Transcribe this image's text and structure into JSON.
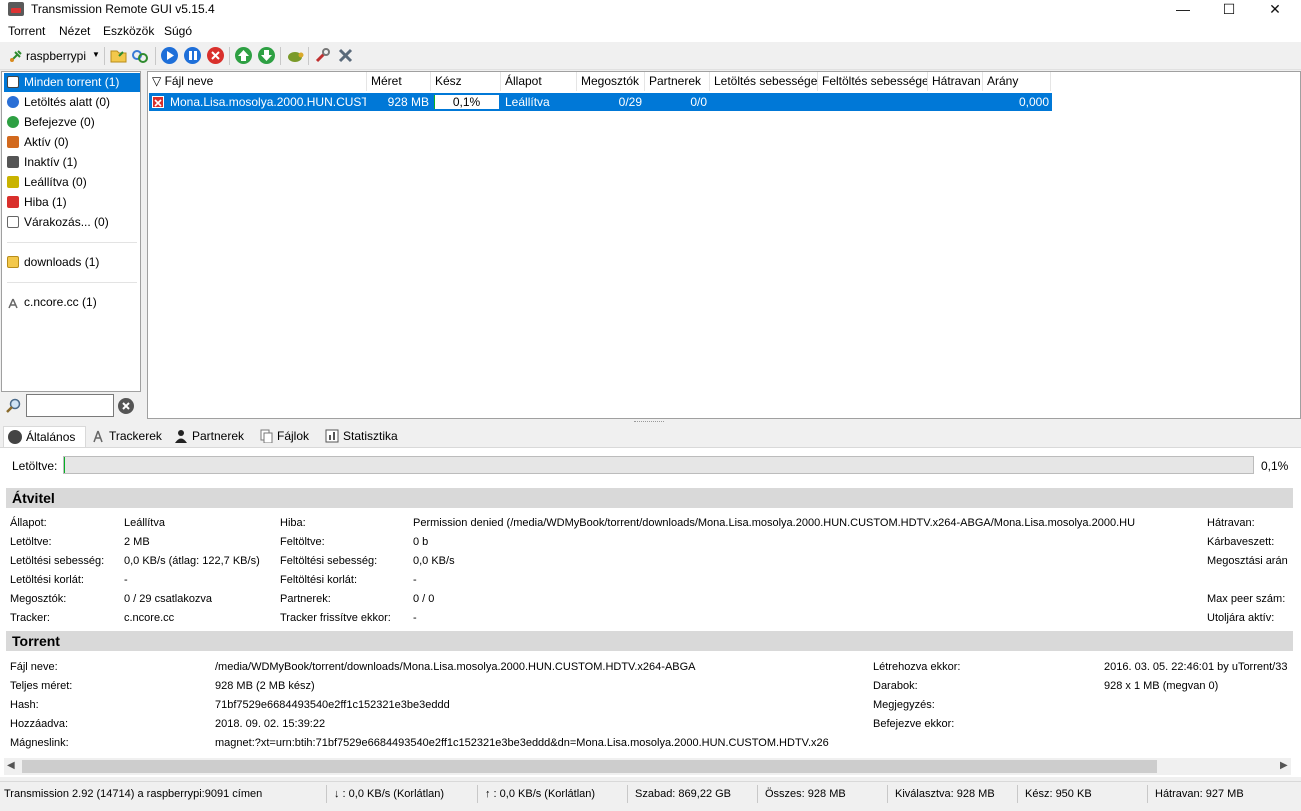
{
  "window": {
    "title": "Transmission Remote GUI v5.15.4",
    "minimize": "—",
    "maximize": "☐",
    "close": "✕"
  },
  "menu": [
    "Torrent",
    "Nézet",
    "Eszközök",
    "Súgó"
  ],
  "toolbar": {
    "connection": "raspberrypi"
  },
  "sidebar": {
    "filters": [
      {
        "label": "Minden torrent (1)",
        "icon": "all-icon",
        "color": "#444444"
      },
      {
        "label": "Letöltés alatt (0)",
        "icon": "download-icon",
        "color": "#2a6fd6"
      },
      {
        "label": "Befejezve (0)",
        "icon": "completed-icon",
        "color": "#2ea043"
      },
      {
        "label": "Aktív (0)",
        "icon": "active-icon",
        "color": "#d2691e"
      },
      {
        "label": "Inaktív (1)",
        "icon": "inactive-icon",
        "color": "#555555"
      },
      {
        "label": "Leállítva (0)",
        "icon": "stopped-icon",
        "color": "#c9b300"
      },
      {
        "label": "Hiba (1)",
        "icon": "error-icon",
        "color": "#d9302c"
      },
      {
        "label": "Várakozás... (0)",
        "icon": "waiting-icon",
        "color": "#666666"
      }
    ],
    "folders": [
      {
        "label": "downloads (1)",
        "icon": "folder-icon"
      }
    ],
    "trackers": [
      {
        "label": "c.ncore.cc (1)",
        "icon": "tracker-icon"
      }
    ]
  },
  "torrent_list": {
    "columns": [
      "Fájl neve",
      "Méret",
      "Kész",
      "Állapot",
      "Megosztók",
      "Partnerek",
      "Letöltés sebessége",
      "Feltöltés sebessége",
      "Hátravan",
      "Arány"
    ],
    "sort_indicator": "▽",
    "rows": [
      {
        "name": "Mona.Lisa.mosolya.2000.HUN.CUSTOM.HDTV.x264-ABGA",
        "size": "928 MB",
        "done": "0,1%",
        "status": "Leállítva",
        "seeds": "0/29",
        "peers": "0/0",
        "down": "",
        "up": "",
        "eta": "",
        "ratio": "0,000"
      }
    ]
  },
  "tabs": [
    "Általános",
    "Trackerek",
    "Partnerek",
    "Fájlok",
    "Statisztika"
  ],
  "general": {
    "downloaded_label": "Letöltve:",
    "downloaded_pct": "0,1%",
    "progress_fraction": 0.001
  },
  "transfer": {
    "heading": "Átvitel",
    "col1": [
      {
        "label": "Állapot:",
        "value": "Leállítva"
      },
      {
        "label": "Letöltve:",
        "value": "2 MB"
      },
      {
        "label": "Letöltési sebesség:",
        "value": "0,0 KB/s (átlag: 122,7 KB/s)"
      },
      {
        "label": "Letöltési korlát:",
        "value": "-"
      },
      {
        "label": "Megosztók:",
        "value": "0 / 29 csatlakozva"
      },
      {
        "label": "Tracker:",
        "value": "c.ncore.cc"
      }
    ],
    "col2": [
      {
        "label": "Hiba:",
        "value": "Permission denied (/media/WDMyBook/torrent/downloads/Mona.Lisa.mosolya.2000.HUN.CUSTOM.HDTV.x264-ABGA/Mona.Lisa.mosolya.2000.HU"
      },
      {
        "label": "Feltöltve:",
        "value": "0 b"
      },
      {
        "label": "Feltöltési sebesség:",
        "value": "0,0 KB/s"
      },
      {
        "label": "Feltöltési korlát:",
        "value": "-"
      },
      {
        "label": "Partnerek:",
        "value": "0 / 0"
      },
      {
        "label": "Tracker frissítve ekkor:",
        "value": "-"
      }
    ],
    "col3": [
      "Hátravan:",
      "Kárbaveszett:",
      "Megosztási arán",
      "",
      "Max peer szám:",
      "Utoljára aktív:"
    ]
  },
  "torrent": {
    "heading": "Torrent",
    "col1": [
      {
        "label": "Fájl neve:",
        "value": "/media/WDMyBook/torrent/downloads/Mona.Lisa.mosolya.2000.HUN.CUSTOM.HDTV.x264-ABGA"
      },
      {
        "label": "Teljes méret:",
        "value": "928 MB (2 MB kész)"
      },
      {
        "label": "Hash:",
        "value": "71bf7529e6684493540e2ff1c152321e3be3eddd"
      },
      {
        "label": "Hozzáadva:",
        "value": "2018. 09. 02. 15:39:22"
      },
      {
        "label": "Mágneslink:",
        "value": "magnet:?xt=urn:btih:71bf7529e6684493540e2ff1c152321e3be3eddd&dn=Mona.Lisa.mosolya.2000.HUN.CUSTOM.HDTV.x26"
      }
    ],
    "col2": [
      {
        "label": "Létrehozva ekkor:",
        "value": "2016. 03. 05. 22:46:01 by uTorrent/33"
      },
      {
        "label": "Darabok:",
        "value": "928 x 1 MB (megvan 0)"
      },
      {
        "label": "Megjegyzés:",
        "value": ""
      },
      {
        "label": "Befejezve ekkor:",
        "value": ""
      }
    ]
  },
  "statusbar": {
    "connection": "Transmission 2.92 (14714) a raspberrypi:9091 címen",
    "down": "↓ : 0,0 KB/s (Korlátlan)",
    "up": "↑ : 0,0 KB/s (Korlátlan)",
    "free": "Szabad: 869,22 GB",
    "total": "Összes: 928 MB",
    "selected": "Kiválasztva: 928 MB",
    "done": "Kész: 950 KB",
    "remaining": "Hátravan: 927 MB"
  }
}
